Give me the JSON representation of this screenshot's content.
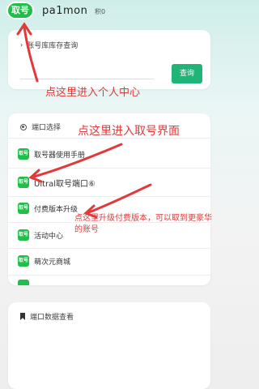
{
  "header": {
    "logo_text": "取号",
    "username": "pa1mon",
    "points": "积0"
  },
  "search_card": {
    "title": "账号库库存查询",
    "query_button": "查询"
  },
  "port_card": {
    "title": "端口选择",
    "items": [
      {
        "label": "取号器使用手册",
        "icon": "取号"
      },
      {
        "label": "Ultral取号端口⑥",
        "icon": "取号"
      },
      {
        "label": "付费版本升级",
        "icon": "取号"
      },
      {
        "label": "活动中心",
        "icon": "取号"
      },
      {
        "label": "萌次元商城",
        "icon": "取号"
      }
    ]
  },
  "data_card": {
    "title": "端口数据查看"
  },
  "annotations": {
    "personal_center": "点这里进入个人中心",
    "get_account": "点这里进入取号界面",
    "upgrade": "点这里升级付费版本，可以取到更豪华的账号"
  },
  "colors": {
    "accent_green": "#1fbf4a",
    "button_green": "#21b478",
    "annotation_red": "#e03a3a"
  }
}
